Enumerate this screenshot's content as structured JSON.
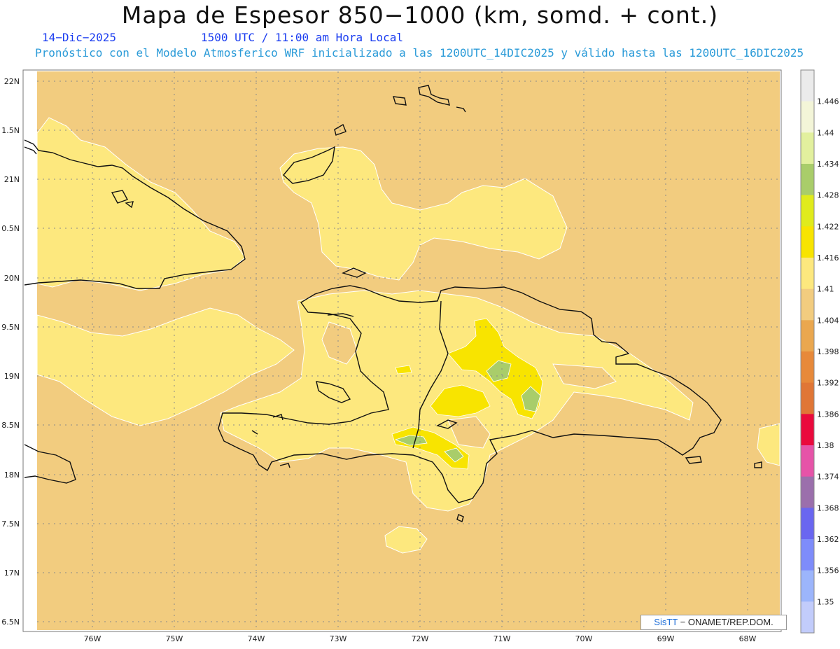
{
  "header": {
    "title": "Mapa de Espesor 850−1000 (km, somd. + cont.)",
    "date": "14−Dic−2025",
    "time": "1500 UTC / 11:00 am Hora Local",
    "description": "Pronóstico con el Modelo Atmosferico WRF inicializado a las 1200UTC_14DIC2025 y válido hasta las  1200UTC_16DIC2025"
  },
  "axes": {
    "lat_labels": [
      "22N",
      "1.5N",
      "21N",
      "0.5N",
      "20N",
      "9.5N",
      "19N",
      "8.5N",
      "18N",
      "7.5N",
      "17N",
      "6.5N"
    ],
    "lon_labels": [
      "76W",
      "75W",
      "74W",
      "73W",
      "72W",
      "71W",
      "70W",
      "69W",
      "68W"
    ]
  },
  "colorbar": {
    "labels": [
      "1.446",
      "1.44",
      "1.434",
      "1.428",
      "1.422",
      "1.416",
      "1.41",
      "1.404",
      "1.398",
      "1.392",
      "1.386",
      "1.38",
      "1.374",
      "1.368",
      "1.362",
      "1.356",
      "1.35"
    ],
    "colors": [
      "#ebebeb",
      "#f3f5d8",
      "#e2f09e",
      "#a9cd6a",
      "#e0eb1c",
      "#f8e400",
      "#fde87e",
      "#f2cc7f",
      "#eaa74f",
      "#e7893a",
      "#e07636",
      "#ea0a3c",
      "#e653a8",
      "#9b6fac",
      "#6a66f0",
      "#7e8cfa",
      "#9cb5fb",
      "#c2ccfb"
    ]
  },
  "colors": {
    "background_field": "#f2cc7f",
    "warm_field": "#fde87e",
    "bright_yellow": "#f8e400",
    "green": "#a9cd6a",
    "coast": "#111111",
    "grid": "#8a8a8a"
  },
  "credit": {
    "brand": "SisTT",
    "text": "− ONAMET/REP.DOM."
  }
}
